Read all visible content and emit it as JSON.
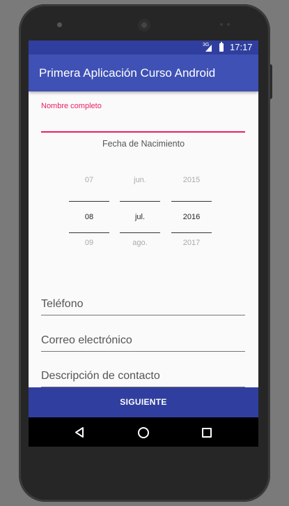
{
  "status_bar": {
    "network": "3G",
    "time": "17:17"
  },
  "app_bar": {
    "title": "Primera Aplicación Curso Android"
  },
  "form": {
    "nombre": {
      "floating_label": "Nombre completo",
      "value": ""
    },
    "date_picker": {
      "label": "Fecha de Nacimiento",
      "day": {
        "prev": "07",
        "selected": "08",
        "next": "09"
      },
      "month": {
        "prev": "jun.",
        "selected": "jul.",
        "next": "ago."
      },
      "year": {
        "prev": "2015",
        "selected": "2016",
        "next": "2017"
      }
    },
    "telefono": {
      "placeholder": "Teléfono"
    },
    "correo": {
      "placeholder": "Correo electrónico"
    },
    "descripcion": {
      "placeholder": "Descripción de contacto"
    }
  },
  "next_button": {
    "label": "SIGUIENTE"
  },
  "nav_bar": {
    "icons": [
      "back-icon",
      "home-icon",
      "recents-icon"
    ]
  },
  "colors": {
    "primary": "#3f51b5",
    "primary_dark": "#303f9f",
    "accent": "#e91e63"
  }
}
